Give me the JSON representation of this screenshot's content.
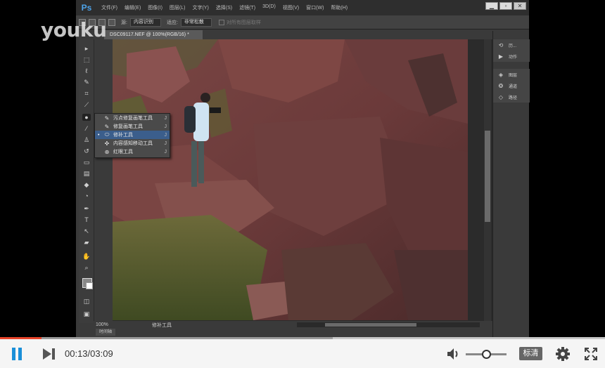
{
  "watermark": "youku",
  "photoshop": {
    "logo": "Ps",
    "menu": [
      "文件(F)",
      "编辑(E)",
      "图像(I)",
      "图层(L)",
      "文字(Y)",
      "选择(S)",
      "滤镜(T)",
      "3D(D)",
      "视图(V)",
      "窗口(W)",
      "帮助(H)"
    ],
    "window_buttons": [
      "minimize-icon",
      "restore-icon",
      "close-icon"
    ],
    "options_bar": {
      "source_label": "源:",
      "source_value": "内容识别",
      "dest_label": "适应:",
      "dest_value": "非常松散",
      "sample_all_label": "对所有图层取样"
    },
    "document_tab": "DSC09117.NEF @ 100%(RGB/16) *",
    "status": {
      "zoom": "100%",
      "tool": "修补工具"
    },
    "mini_tab": "时间轴",
    "flyout": {
      "items": [
        {
          "label": "污点修复画笔工具",
          "key": "J",
          "icon": "spot-heal-icon",
          "active": false
        },
        {
          "label": "修复画笔工具",
          "key": "J",
          "icon": "heal-brush-icon",
          "active": false
        },
        {
          "label": "修补工具",
          "key": "J",
          "icon": "patch-icon",
          "active": true
        },
        {
          "label": "内容感知移动工具",
          "key": "J",
          "icon": "content-move-icon",
          "active": false
        },
        {
          "label": "红眼工具",
          "key": "J",
          "icon": "red-eye-icon",
          "active": false
        }
      ]
    },
    "panels": {
      "group1": [
        {
          "icon": "history-icon",
          "label": "历..."
        },
        {
          "icon": "actions-icon",
          "label": "动作"
        }
      ],
      "group2": [
        {
          "icon": "layers-icon",
          "label": "图层"
        },
        {
          "icon": "channels-icon",
          "label": "通道"
        },
        {
          "icon": "paths-icon",
          "label": "路径"
        }
      ]
    }
  },
  "player": {
    "time": "00:13/03:09",
    "quality": "标清",
    "progress": 0.069,
    "buffered": 0.55,
    "volume": 0.5
  }
}
